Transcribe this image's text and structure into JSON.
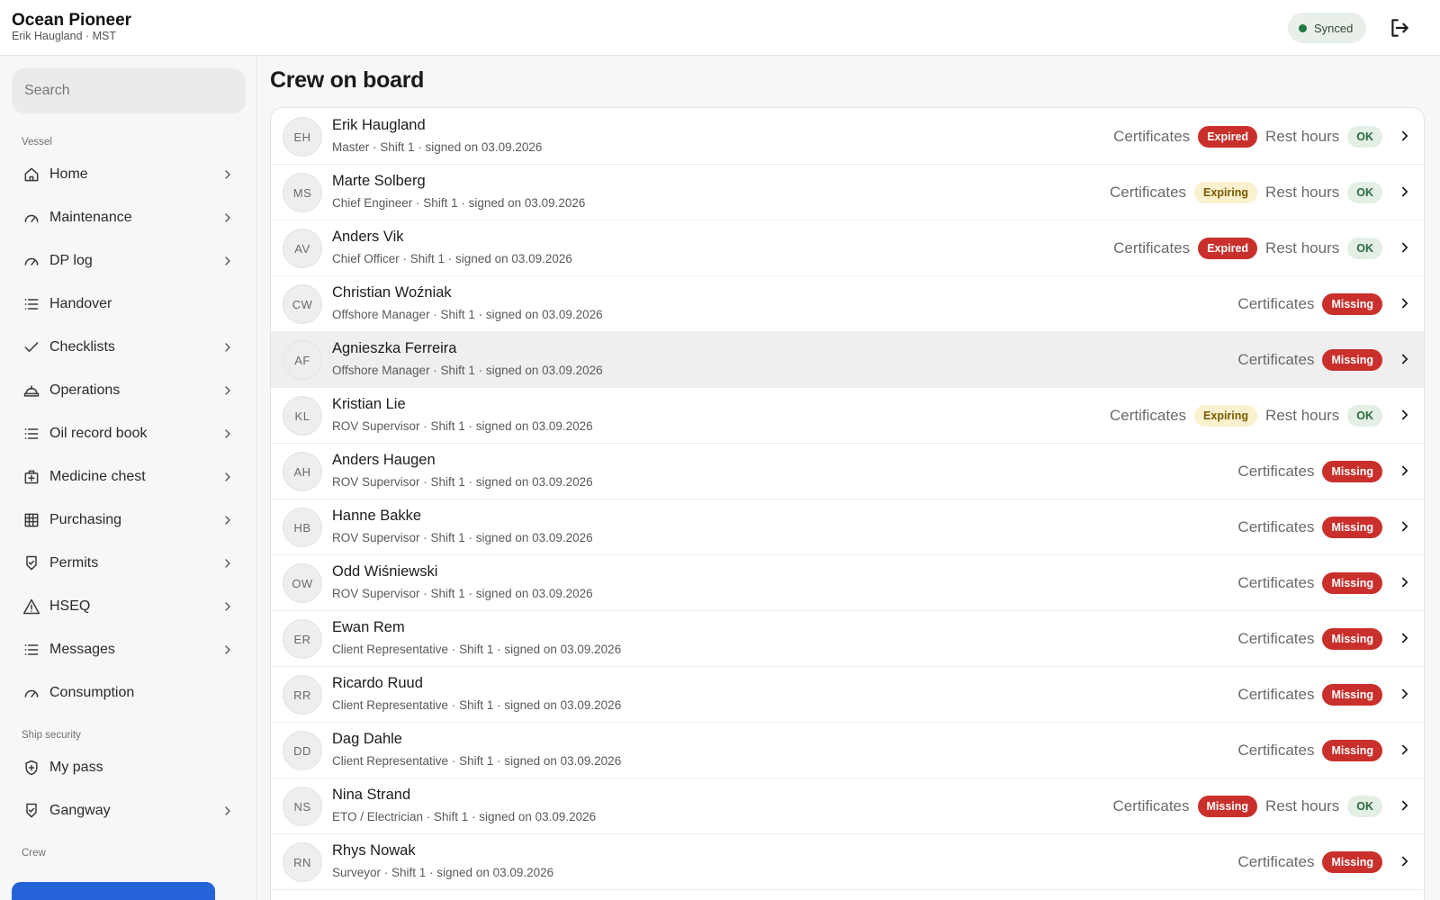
{
  "header": {
    "title": "Ocean Pioneer",
    "subtitle": "Erik Haugland · MST",
    "sync_status": "Synced"
  },
  "sidebar": {
    "search_placeholder": "Search",
    "section_vessel": "Vessel",
    "section_ship_security": "Ship security",
    "section_crew": "Crew",
    "items": [
      {
        "label": "Home",
        "icon": "home-icon",
        "chevron": true
      },
      {
        "label": "Maintenance",
        "icon": "gauge-icon",
        "chevron": true
      },
      {
        "label": "DP log",
        "icon": "gauge-icon",
        "chevron": true
      },
      {
        "label": "Handover",
        "icon": "list-icon",
        "chevron": false
      },
      {
        "label": "Checklists",
        "icon": "check-icon",
        "chevron": true
      },
      {
        "label": "Operations",
        "icon": "helmet-icon",
        "chevron": true
      },
      {
        "label": "Oil record book",
        "icon": "list-icon",
        "chevron": true
      },
      {
        "label": "Medicine chest",
        "icon": "medkit-icon",
        "chevron": true
      },
      {
        "label": "Purchasing",
        "icon": "grid-icon",
        "chevron": true
      },
      {
        "label": "Permits",
        "icon": "shield-check-icon",
        "chevron": true
      },
      {
        "label": "HSEQ",
        "icon": "warning-icon",
        "chevron": true
      },
      {
        "label": "Messages",
        "icon": "list-icon",
        "chevron": true
      },
      {
        "label": "Consumption",
        "icon": "gauge-icon",
        "chevron": false
      }
    ],
    "security_items": [
      {
        "label": "My pass",
        "icon": "shield-plus-icon",
        "chevron": false
      },
      {
        "label": "Gangway",
        "icon": "shield-check-icon",
        "chevron": true
      }
    ]
  },
  "main": {
    "title": "Crew on board",
    "certificates_label": "Certificates",
    "rest_hours_label": "Rest hours",
    "crew": [
      {
        "initials": "EH",
        "name": "Erik Haugland",
        "meta": "Master · Shift 1 · signed on 03.09.2026",
        "cert": "Expired",
        "rest": "OK"
      },
      {
        "initials": "MS",
        "name": "Marte Solberg",
        "meta": "Chief Engineer · Shift 1 · signed on 03.09.2026",
        "cert": "Expiring",
        "rest": "OK"
      },
      {
        "initials": "AV",
        "name": "Anders Vik",
        "meta": "Chief Officer · Shift 1 · signed on 03.09.2026",
        "cert": "Expired",
        "rest": "OK"
      },
      {
        "initials": "CW",
        "name": "Christian Woźniak",
        "meta": "Offshore Manager · Shift 1 · signed on 03.09.2026",
        "cert": "Missing",
        "rest": null
      },
      {
        "initials": "AF",
        "name": "Agnieszka Ferreira",
        "meta": "Offshore Manager · Shift 1 · signed on 03.09.2026",
        "cert": "Missing",
        "rest": null,
        "highlight": true
      },
      {
        "initials": "KL",
        "name": "Kristian Lie",
        "meta": "ROV Supervisor · Shift 1 · signed on 03.09.2026",
        "cert": "Expiring",
        "rest": "OK"
      },
      {
        "initials": "AH",
        "name": "Anders Haugen",
        "meta": "ROV Supervisor · Shift 1 · signed on 03.09.2026",
        "cert": "Missing",
        "rest": null
      },
      {
        "initials": "HB",
        "name": "Hanne Bakke",
        "meta": "ROV Supervisor · Shift 1 · signed on 03.09.2026",
        "cert": "Missing",
        "rest": null
      },
      {
        "initials": "OW",
        "name": "Odd Wiśniewski",
        "meta": "ROV Supervisor · Shift 1 · signed on 03.09.2026",
        "cert": "Missing",
        "rest": null
      },
      {
        "initials": "ER",
        "name": "Ewan Rem",
        "meta": "Client Representative · Shift 1 · signed on 03.09.2026",
        "cert": "Missing",
        "rest": null
      },
      {
        "initials": "RR",
        "name": "Ricardo Ruud",
        "meta": "Client Representative · Shift 1 · signed on 03.09.2026",
        "cert": "Missing",
        "rest": null
      },
      {
        "initials": "DD",
        "name": "Dag Dahle",
        "meta": "Client Representative · Shift 1 · signed on 03.09.2026",
        "cert": "Missing",
        "rest": null
      },
      {
        "initials": "NS",
        "name": "Nina Strand",
        "meta": "ETO / Electrician · Shift 1 · signed on 03.09.2026",
        "cert": "Missing",
        "rest": "OK"
      },
      {
        "initials": "RN",
        "name": "Rhys Nowak",
        "meta": "Surveyor · Shift 1 · signed on 03.09.2026",
        "cert": "Missing",
        "rest": null
      }
    ]
  },
  "colors": {
    "accent": "#2563d9",
    "status_red": "#c9302c",
    "status_yellow_bg": "#fbf1cf",
    "status_green_bg": "#e3efe5",
    "sync_dot": "#1f7a3f"
  }
}
